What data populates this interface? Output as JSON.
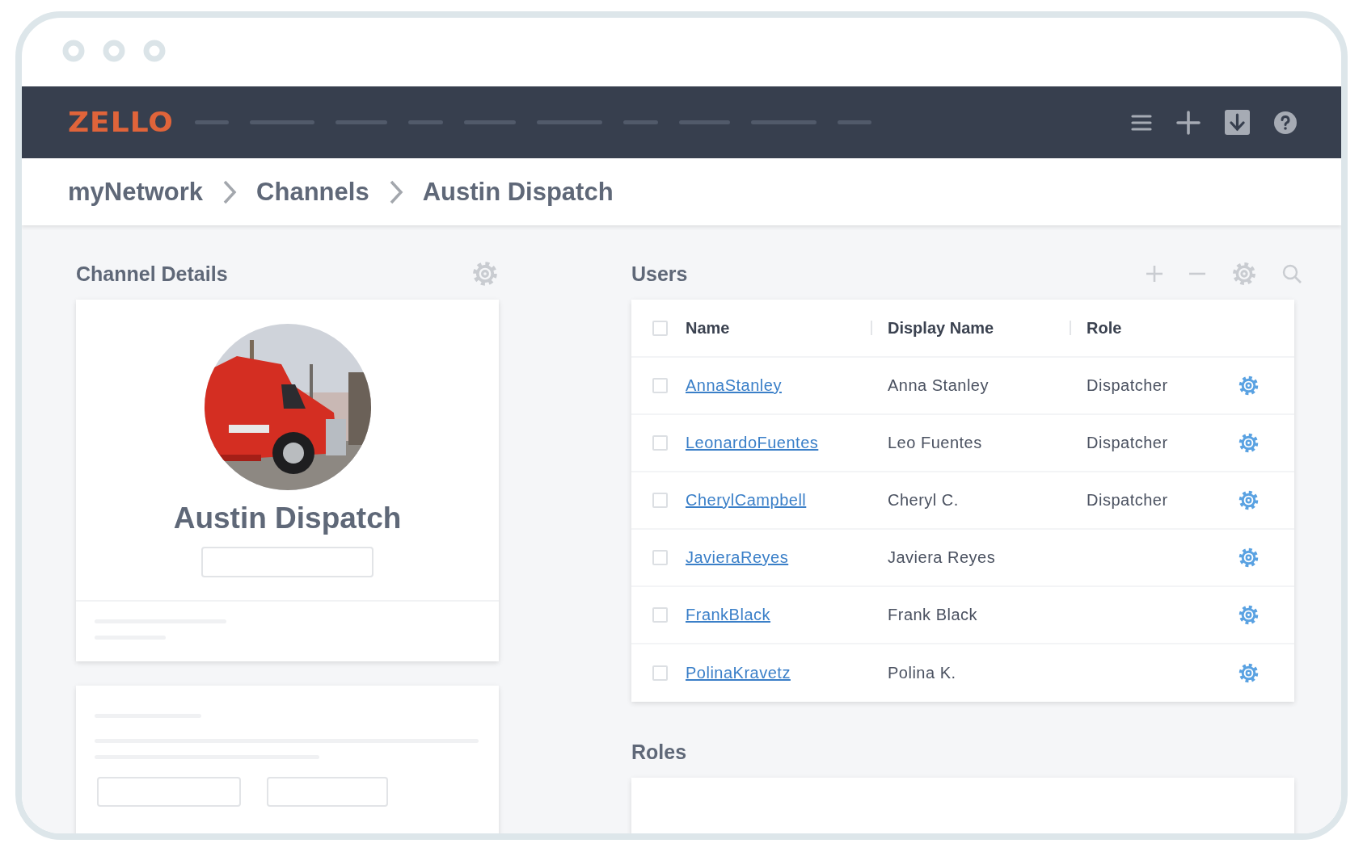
{
  "navbar": {
    "logo": "ZELLO"
  },
  "breadcrumb": [
    "myNetwork",
    "Channels",
    "Austin Dispatch"
  ],
  "channel_details": {
    "title": "Channel Details",
    "channel_name": "Austin Dispatch"
  },
  "users": {
    "title": "Users",
    "columns": [
      "Name",
      "Display Name",
      "Role"
    ],
    "select_all_checked": false,
    "rows": [
      {
        "name": "AnnaStanley",
        "display_name": "Anna Stanley",
        "role": "Dispatcher",
        "checked": false
      },
      {
        "name": "LeonardoFuentes",
        "display_name": "Leo Fuentes",
        "role": "Dispatcher",
        "checked": false
      },
      {
        "name": "CherylCampbell",
        "display_name": "Cheryl C.",
        "role": "Dispatcher",
        "checked": false
      },
      {
        "name": "JavieraReyes",
        "display_name": "Javiera Reyes",
        "checked": false
      },
      {
        "name": "FrankBlack",
        "display_name": "Frank Black",
        "checked": false
      },
      {
        "name": "PolinaKravetz",
        "display_name": "Polina K.",
        "checked": false
      }
    ]
  },
  "roles": {
    "title": "Roles"
  }
}
